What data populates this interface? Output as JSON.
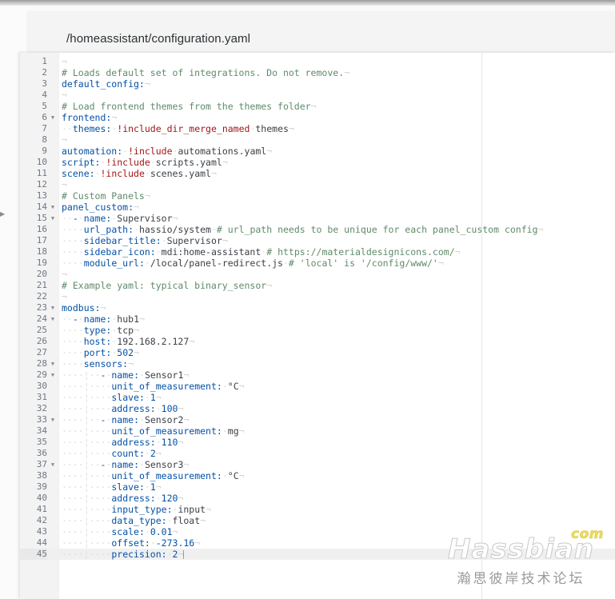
{
  "window": {
    "file_path": "/homeassistant/configuration.yaml"
  },
  "editor": {
    "active_line": 45,
    "ruler_column": 80,
    "colors": {
      "key": "#0451a5",
      "comment": "#5f8a69",
      "value": "#3b3f44",
      "number": "#0451a5",
      "tag": "#a31515",
      "gutter_bg": "#f3f3f3",
      "active_line_bg": "#f0f0f0"
    },
    "lines": [
      {
        "n": 1,
        "fold": false,
        "plain": ""
      },
      {
        "n": 2,
        "fold": false,
        "plain": "# Loads default set of integrations. Do not remove."
      },
      {
        "n": 3,
        "fold": false,
        "plain": "default_config:"
      },
      {
        "n": 4,
        "fold": false,
        "plain": ""
      },
      {
        "n": 5,
        "fold": false,
        "plain": "# Load frontend themes from the themes folder"
      },
      {
        "n": 6,
        "fold": true,
        "plain": "frontend:"
      },
      {
        "n": 7,
        "fold": false,
        "plain": "  themes: !include_dir_merge_named themes"
      },
      {
        "n": 8,
        "fold": false,
        "plain": ""
      },
      {
        "n": 9,
        "fold": false,
        "plain": "automation: !include automations.yaml"
      },
      {
        "n": 10,
        "fold": false,
        "plain": "script: !include scripts.yaml"
      },
      {
        "n": 11,
        "fold": false,
        "plain": "scene: !include scenes.yaml"
      },
      {
        "n": 12,
        "fold": false,
        "plain": ""
      },
      {
        "n": 13,
        "fold": false,
        "plain": "# Custom Panels"
      },
      {
        "n": 14,
        "fold": true,
        "plain": "panel_custom:"
      },
      {
        "n": 15,
        "fold": true,
        "plain": "  - name: Supervisor"
      },
      {
        "n": 16,
        "fold": false,
        "plain": "    url_path: hassio/system # url_path needs to be unique for each panel_custom config"
      },
      {
        "n": 17,
        "fold": false,
        "plain": "    sidebar_title: Supervisor"
      },
      {
        "n": 18,
        "fold": false,
        "plain": "    sidebar_icon: mdi:home-assistant # https://materialdesignicons.com/"
      },
      {
        "n": 19,
        "fold": false,
        "plain": "    module_url: /local/panel-redirect.js # 'local' is '/config/www/'"
      },
      {
        "n": 20,
        "fold": false,
        "plain": ""
      },
      {
        "n": 21,
        "fold": false,
        "plain": "# Example yaml: typical binary_sensor"
      },
      {
        "n": 22,
        "fold": false,
        "plain": ""
      },
      {
        "n": 23,
        "fold": true,
        "plain": "modbus:"
      },
      {
        "n": 24,
        "fold": true,
        "plain": "  - name: hub1"
      },
      {
        "n": 25,
        "fold": false,
        "plain": "    type: tcp"
      },
      {
        "n": 26,
        "fold": false,
        "plain": "    host: 192.168.2.127"
      },
      {
        "n": 27,
        "fold": false,
        "plain": "    port: 502"
      },
      {
        "n": 28,
        "fold": true,
        "plain": "    sensors:"
      },
      {
        "n": 29,
        "fold": true,
        "plain": "      - name: Sensor1"
      },
      {
        "n": 30,
        "fold": false,
        "plain": "        unit_of_measurement: °C"
      },
      {
        "n": 31,
        "fold": false,
        "plain": "        slave: 1"
      },
      {
        "n": 32,
        "fold": false,
        "plain": "        address: 100"
      },
      {
        "n": 33,
        "fold": true,
        "plain": "      - name: Sensor2"
      },
      {
        "n": 34,
        "fold": false,
        "plain": "        unit_of_measurement: mg"
      },
      {
        "n": 35,
        "fold": false,
        "plain": "        address: 110"
      },
      {
        "n": 36,
        "fold": false,
        "plain": "        count: 2"
      },
      {
        "n": 37,
        "fold": true,
        "plain": "      - name: Sensor3"
      },
      {
        "n": 38,
        "fold": false,
        "plain": "        unit_of_measurement: °C"
      },
      {
        "n": 39,
        "fold": false,
        "plain": "        slave: 1"
      },
      {
        "n": 40,
        "fold": false,
        "plain": "        address: 120"
      },
      {
        "n": 41,
        "fold": false,
        "plain": "        input_type: input"
      },
      {
        "n": 42,
        "fold": false,
        "plain": "        data_type: float"
      },
      {
        "n": 43,
        "fold": false,
        "plain": "        scale: 0.01"
      },
      {
        "n": 44,
        "fold": false,
        "plain": "        offset: -273.16"
      },
      {
        "n": 45,
        "fold": false,
        "plain": "        precision: 2"
      }
    ],
    "tokens": [
      [],
      [
        [
          "cmt",
          "# Loads default set of integrations. Do not remove."
        ]
      ],
      [
        [
          "k",
          "default_config:"
        ]
      ],
      [],
      [
        [
          "cmt",
          "# Load frontend themes from the themes folder"
        ]
      ],
      [
        [
          "k",
          "frontend:"
        ]
      ],
      [
        [
          "ws",
          "··"
        ],
        [
          "k",
          "themes:"
        ],
        [
          "ws",
          "·"
        ],
        [
          "tag",
          "!include_dir_merge_named"
        ],
        [
          "ws",
          "·"
        ],
        [
          "val",
          "themes"
        ]
      ],
      [],
      [
        [
          "k",
          "automation:"
        ],
        [
          "ws",
          "·"
        ],
        [
          "tag",
          "!include"
        ],
        [
          "ws",
          "·"
        ],
        [
          "val",
          "automations.yaml"
        ]
      ],
      [
        [
          "k",
          "script:"
        ],
        [
          "ws",
          "·"
        ],
        [
          "tag",
          "!include"
        ],
        [
          "ws",
          "·"
        ],
        [
          "val",
          "scripts.yaml"
        ]
      ],
      [
        [
          "k",
          "scene:"
        ],
        [
          "ws",
          "·"
        ],
        [
          "tag",
          "!include"
        ],
        [
          "ws",
          "·"
        ],
        [
          "val",
          "scenes.yaml"
        ]
      ],
      [],
      [
        [
          "cmt",
          "# Custom Panels"
        ]
      ],
      [
        [
          "k",
          "panel_custom:"
        ]
      ],
      [
        [
          "ws",
          "··"
        ],
        [
          "dash",
          "-"
        ],
        [
          "ws",
          "·"
        ],
        [
          "k",
          "name:"
        ],
        [
          "ws",
          "·"
        ],
        [
          "val",
          "Supervisor"
        ]
      ],
      [
        [
          "ws",
          "····"
        ],
        [
          "k",
          "url_path:"
        ],
        [
          "ws",
          "·"
        ],
        [
          "val",
          "hassio/system"
        ],
        [
          "ws",
          "·"
        ],
        [
          "cmt",
          "# url_path needs to be unique for each panel_custom config"
        ]
      ],
      [
        [
          "ws",
          "····"
        ],
        [
          "k",
          "sidebar_title:"
        ],
        [
          "ws",
          "·"
        ],
        [
          "val",
          "Supervisor"
        ]
      ],
      [
        [
          "ws",
          "····"
        ],
        [
          "k",
          "sidebar_icon:"
        ],
        [
          "ws",
          "·"
        ],
        [
          "val",
          "mdi:home-assistant"
        ],
        [
          "ws",
          "·"
        ],
        [
          "cmt",
          "# https://materialdesignicons.com/"
        ]
      ],
      [
        [
          "ws",
          "····"
        ],
        [
          "k",
          "module_url:"
        ],
        [
          "ws",
          "·"
        ],
        [
          "val",
          "/local/panel-redirect.js"
        ],
        [
          "ws",
          "·"
        ],
        [
          "cmt",
          "# 'local' is '/config/www/'"
        ]
      ],
      [],
      [
        [
          "cmt",
          "# Example yaml: typical binary_sensor"
        ]
      ],
      [],
      [
        [
          "k",
          "modbus:"
        ]
      ],
      [
        [
          "ws",
          "··"
        ],
        [
          "dash",
          "-"
        ],
        [
          "ws",
          "·"
        ],
        [
          "k",
          "name:"
        ],
        [
          "ws",
          "·"
        ],
        [
          "val",
          "hub1"
        ]
      ],
      [
        [
          "ws",
          "····"
        ],
        [
          "k",
          "type:"
        ],
        [
          "ws",
          "·"
        ],
        [
          "val",
          "tcp"
        ]
      ],
      [
        [
          "ws",
          "····"
        ],
        [
          "k",
          "host:"
        ],
        [
          "ws",
          "·"
        ],
        [
          "val",
          "192.168.2.127"
        ]
      ],
      [
        [
          "ws",
          "····"
        ],
        [
          "k",
          "port:"
        ],
        [
          "ws",
          "·"
        ],
        [
          "num",
          "502"
        ]
      ],
      [
        [
          "ws",
          "····"
        ],
        [
          "k",
          "sensors:"
        ]
      ],
      [
        [
          "ws",
          "····"
        ],
        [
          "guide",
          "¦"
        ],
        [
          "ws",
          "··"
        ],
        [
          "dash",
          "-"
        ],
        [
          "ws",
          "·"
        ],
        [
          "k",
          "name:"
        ],
        [
          "ws",
          "·"
        ],
        [
          "val",
          "Sensor1"
        ]
      ],
      [
        [
          "ws",
          "····"
        ],
        [
          "guide",
          "¦"
        ],
        [
          "ws",
          "····"
        ],
        [
          "k",
          "unit_of_measurement:"
        ],
        [
          "ws",
          "·"
        ],
        [
          "val",
          "°C"
        ]
      ],
      [
        [
          "ws",
          "····"
        ],
        [
          "guide",
          "¦"
        ],
        [
          "ws",
          "····"
        ],
        [
          "k",
          "slave:"
        ],
        [
          "ws",
          "·"
        ],
        [
          "num",
          "1"
        ]
      ],
      [
        [
          "ws",
          "····"
        ],
        [
          "guide",
          "¦"
        ],
        [
          "ws",
          "····"
        ],
        [
          "k",
          "address:"
        ],
        [
          "ws",
          "·"
        ],
        [
          "num",
          "100"
        ]
      ],
      [
        [
          "ws",
          "····"
        ],
        [
          "guide",
          "¦"
        ],
        [
          "ws",
          "··"
        ],
        [
          "dash",
          "-"
        ],
        [
          "ws",
          "·"
        ],
        [
          "k",
          "name:"
        ],
        [
          "ws",
          "·"
        ],
        [
          "val",
          "Sensor2"
        ]
      ],
      [
        [
          "ws",
          "····"
        ],
        [
          "guide",
          "¦"
        ],
        [
          "ws",
          "····"
        ],
        [
          "k",
          "unit_of_measurement:"
        ],
        [
          "ws",
          "·"
        ],
        [
          "val",
          "mg"
        ]
      ],
      [
        [
          "ws",
          "····"
        ],
        [
          "guide",
          "¦"
        ],
        [
          "ws",
          "····"
        ],
        [
          "k",
          "address:"
        ],
        [
          "ws",
          "·"
        ],
        [
          "num",
          "110"
        ]
      ],
      [
        [
          "ws",
          "····"
        ],
        [
          "guide",
          "¦"
        ],
        [
          "ws",
          "····"
        ],
        [
          "k",
          "count:"
        ],
        [
          "ws",
          "·"
        ],
        [
          "num",
          "2"
        ]
      ],
      [
        [
          "ws",
          "····"
        ],
        [
          "guide",
          "¦"
        ],
        [
          "ws",
          "··"
        ],
        [
          "dash",
          "-"
        ],
        [
          "ws",
          "·"
        ],
        [
          "k",
          "name:"
        ],
        [
          "ws",
          "·"
        ],
        [
          "val",
          "Sensor3"
        ]
      ],
      [
        [
          "ws",
          "····"
        ],
        [
          "guide",
          "¦"
        ],
        [
          "ws",
          "····"
        ],
        [
          "k",
          "unit_of_measurement:"
        ],
        [
          "ws",
          "·"
        ],
        [
          "val",
          "°C"
        ]
      ],
      [
        [
          "ws",
          "····"
        ],
        [
          "guide",
          "¦"
        ],
        [
          "ws",
          "····"
        ],
        [
          "k",
          "slave:"
        ],
        [
          "ws",
          "·"
        ],
        [
          "num",
          "1"
        ]
      ],
      [
        [
          "ws",
          "····"
        ],
        [
          "guide",
          "¦"
        ],
        [
          "ws",
          "····"
        ],
        [
          "k",
          "address:"
        ],
        [
          "ws",
          "·"
        ],
        [
          "num",
          "120"
        ]
      ],
      [
        [
          "ws",
          "····"
        ],
        [
          "guide",
          "¦"
        ],
        [
          "ws",
          "····"
        ],
        [
          "k",
          "input_type:"
        ],
        [
          "ws",
          "·"
        ],
        [
          "val",
          "input"
        ]
      ],
      [
        [
          "ws",
          "····"
        ],
        [
          "guide",
          "¦"
        ],
        [
          "ws",
          "····"
        ],
        [
          "k",
          "data_type:"
        ],
        [
          "ws",
          "·"
        ],
        [
          "val",
          "float"
        ]
      ],
      [
        [
          "ws",
          "····"
        ],
        [
          "guide",
          "¦"
        ],
        [
          "ws",
          "····"
        ],
        [
          "k",
          "scale:"
        ],
        [
          "ws",
          "·"
        ],
        [
          "num",
          "0.01"
        ]
      ],
      [
        [
          "ws",
          "····"
        ],
        [
          "guide",
          "¦"
        ],
        [
          "ws",
          "····"
        ],
        [
          "k",
          "offset:"
        ],
        [
          "ws",
          "·"
        ],
        [
          "num",
          "-273.16"
        ]
      ],
      [
        [
          "ws",
          "····"
        ],
        [
          "guide",
          "¦"
        ],
        [
          "ws",
          "····"
        ],
        [
          "k",
          "precision:"
        ],
        [
          "ws",
          "·"
        ],
        [
          "num",
          "2"
        ]
      ]
    ]
  },
  "watermark": {
    "brand": "Hassbian",
    "tld": "com",
    "subtitle": "瀚思彼岸技术论坛"
  }
}
